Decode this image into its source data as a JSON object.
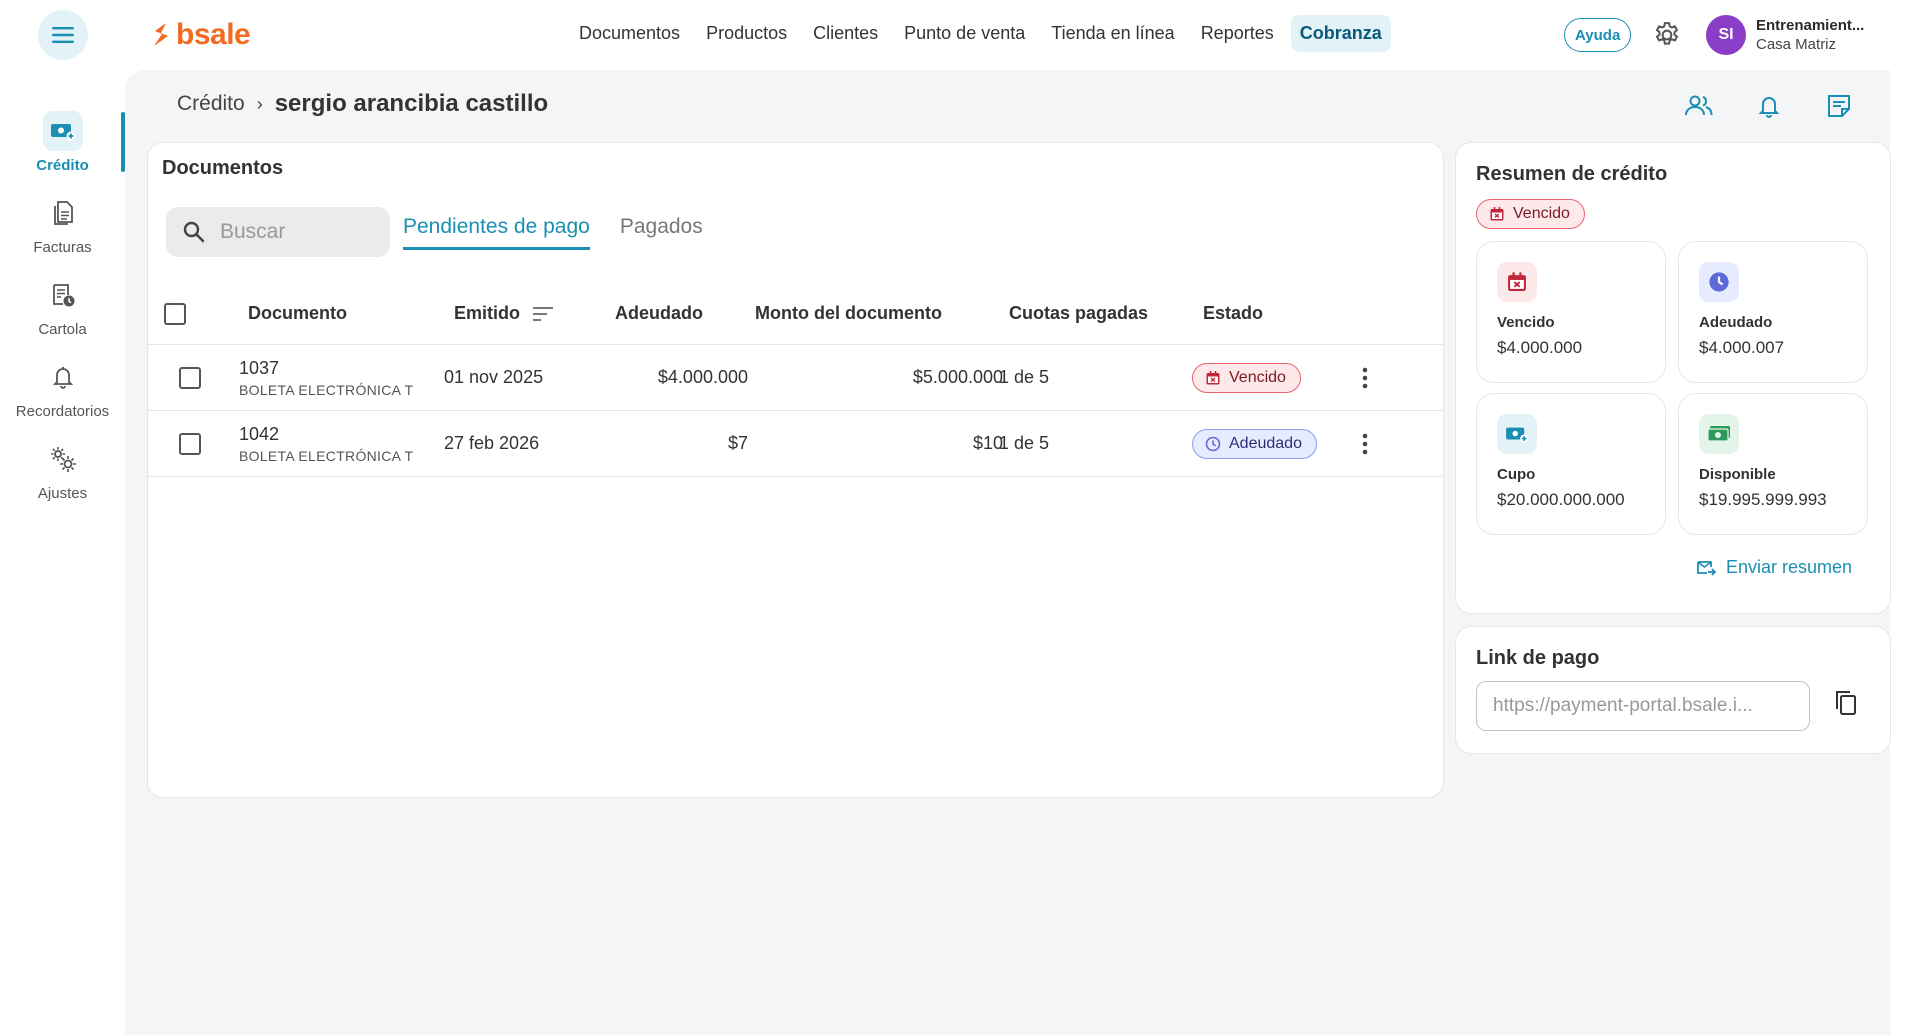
{
  "header": {
    "logo_text": "bsale",
    "nav": [
      "Documentos",
      "Productos",
      "Clientes",
      "Punto de venta",
      "Tienda en línea",
      "Reportes",
      "Cobranza"
    ],
    "active_nav": "Cobranza",
    "help_label": "Ayuda",
    "avatar_initials": "SI",
    "account_name": "Entrenamient...",
    "account_branch": "Casa Matriz"
  },
  "sidebar": {
    "items": [
      {
        "label": "Crédito",
        "icon": "money-plus-icon",
        "active": true
      },
      {
        "label": "Facturas",
        "icon": "documents-icon",
        "active": false
      },
      {
        "label": "Cartola",
        "icon": "statement-clock-icon",
        "active": false
      },
      {
        "label": "Recordatorios",
        "icon": "bell-icon",
        "active": false
      },
      {
        "label": "Ajustes",
        "icon": "gears-icon",
        "active": false
      }
    ]
  },
  "breadcrumb": {
    "parent": "Crédito",
    "separator": "›",
    "current": "sergio arancibia castillo"
  },
  "documents": {
    "title": "Documentos",
    "search_placeholder": "Buscar",
    "tabs": [
      "Pendientes de pago",
      "Pagados"
    ],
    "active_tab": "Pendientes de pago",
    "columns": [
      "Documento",
      "Emitido",
      "Adeudado",
      "Monto del documento",
      "Cuotas pagadas",
      "Estado"
    ],
    "rows": [
      {
        "number": "1037",
        "type": "BOLETA ELECTRÓNICA T",
        "issued": "01 nov 2025",
        "owed": "$4.000.000",
        "amount": "$5.000.000",
        "installments": "1 de 5",
        "status": "Vencido",
        "status_kind": "vencido"
      },
      {
        "number": "1042",
        "type": "BOLETA ELECTRÓNICA T",
        "issued": "27 feb 2026",
        "owed": "$7",
        "amount": "$10",
        "installments": "1 de 5",
        "status": "Adeudado",
        "status_kind": "adeudado"
      }
    ]
  },
  "summary": {
    "title": "Resumen de crédito",
    "status": "Vencido",
    "stats": [
      {
        "label": "Vencido",
        "value": "$4.000.000",
        "icon": "calendar-x-icon",
        "color": "#c0273a",
        "bg": "#fde8ea"
      },
      {
        "label": "Adeudado",
        "value": "$4.000.007",
        "icon": "clock-icon",
        "color": "#5b6ad8",
        "bg": "#e6ebff"
      },
      {
        "label": "Cupo",
        "value": "$20.000.000.000",
        "icon": "money-plus-icon",
        "color": "#1a8fb3",
        "bg": "#e3f2f7"
      },
      {
        "label": "Disponible",
        "value": "$19.995.999.993",
        "icon": "cash-icon",
        "color": "#2e9a5a",
        "bg": "#e3f5ea"
      }
    ],
    "send_label": "Enviar resumen"
  },
  "payment_link": {
    "title": "Link de pago",
    "value": "https://payment-portal.bsale.i..."
  },
  "colors": {
    "accent": "#1a8fb3",
    "brand": "#f26b21",
    "danger": "#c0273a",
    "owed": "#5b6ad8"
  }
}
